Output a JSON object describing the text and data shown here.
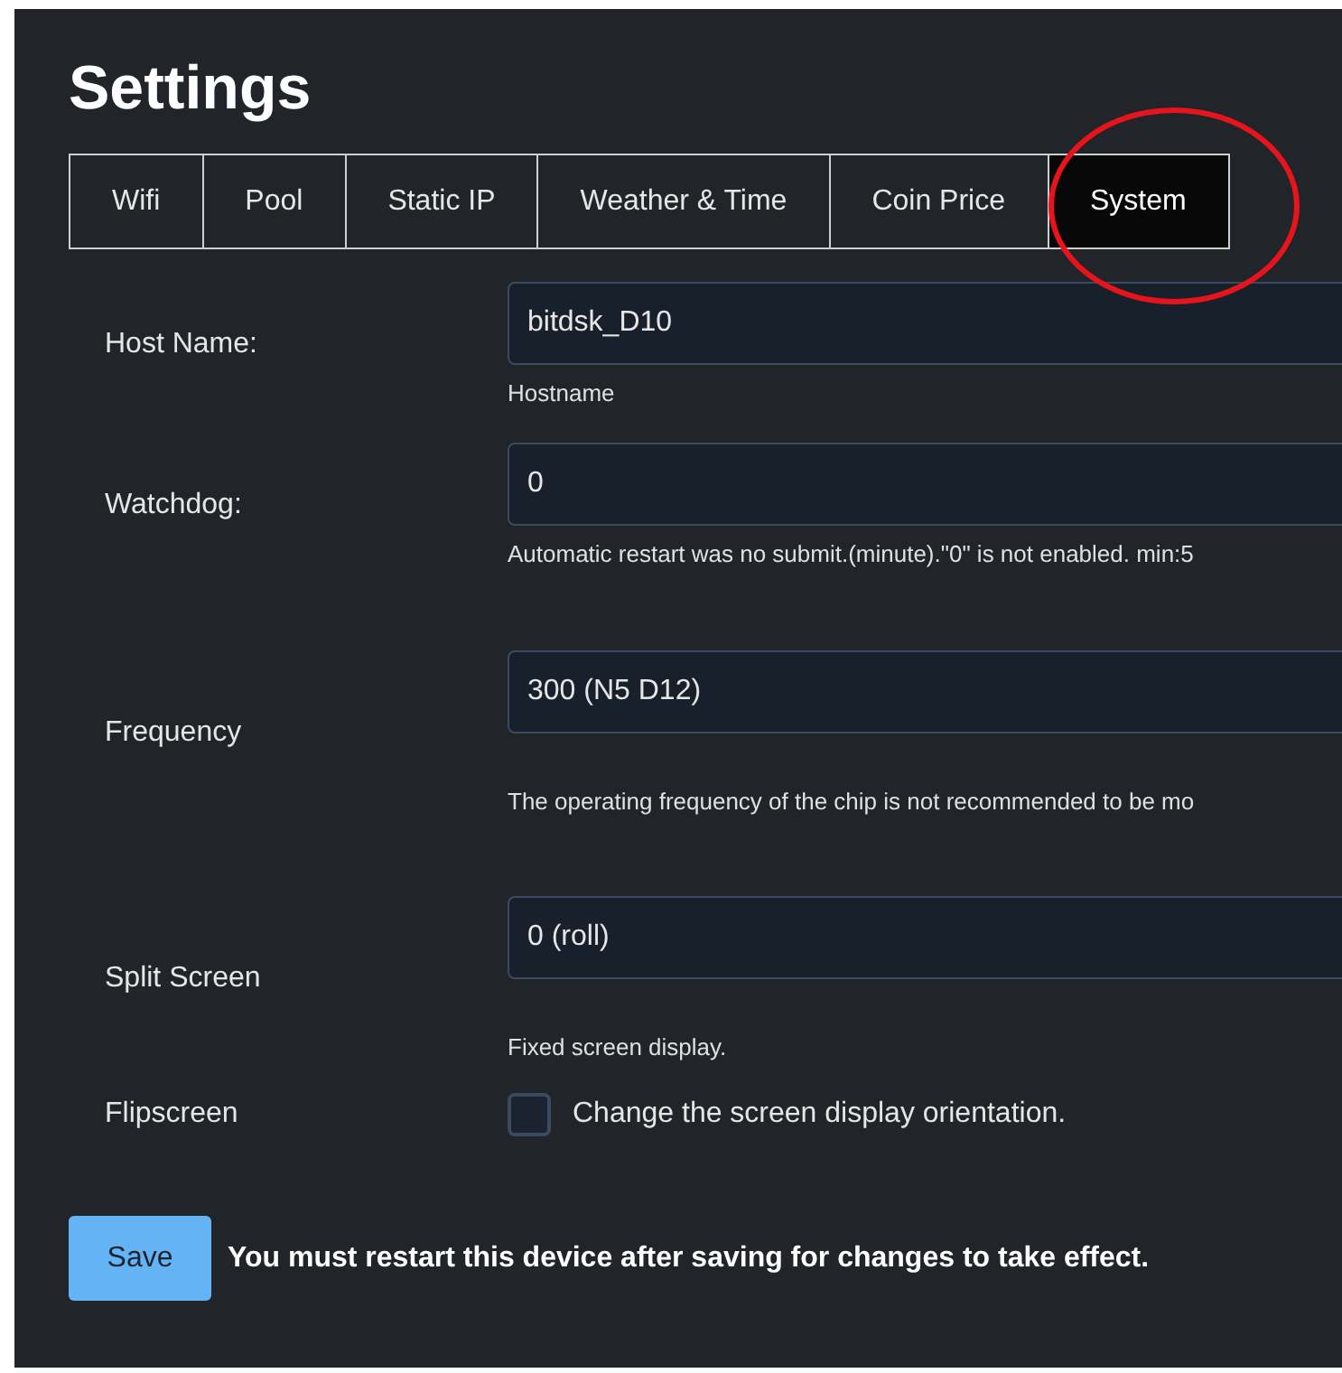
{
  "title": "Settings",
  "tabs": [
    {
      "label": "Wifi",
      "selected": false
    },
    {
      "label": "Pool",
      "selected": false
    },
    {
      "label": "Static IP",
      "selected": false
    },
    {
      "label": "Weather & Time",
      "selected": false
    },
    {
      "label": "Coin Price",
      "selected": false
    },
    {
      "label": "System",
      "selected": true
    }
  ],
  "fields": [
    {
      "kind": "input",
      "label": "Host Name:",
      "value": "bitdsk_D10",
      "hint": "Hostname"
    },
    {
      "kind": "input",
      "label": "Watchdog:",
      "value": "0",
      "hint": "Automatic restart was no submit.(minute).\"0\" is not enabled. min:5"
    },
    {
      "kind": "select",
      "label": "Frequency",
      "value": "300 (N5 D12)",
      "hint": "The operating frequency of the chip is not recommended to be mo"
    },
    {
      "kind": "select",
      "label": "Split Screen",
      "value": "0 (roll)",
      "hint": "Fixed screen display."
    },
    {
      "kind": "checkbox",
      "label": "Flipscreen",
      "checked": false,
      "text": "Change the screen display orientation."
    }
  ],
  "save_button": "Save",
  "notice": "You must restart this device after saving for changes to take effect."
}
